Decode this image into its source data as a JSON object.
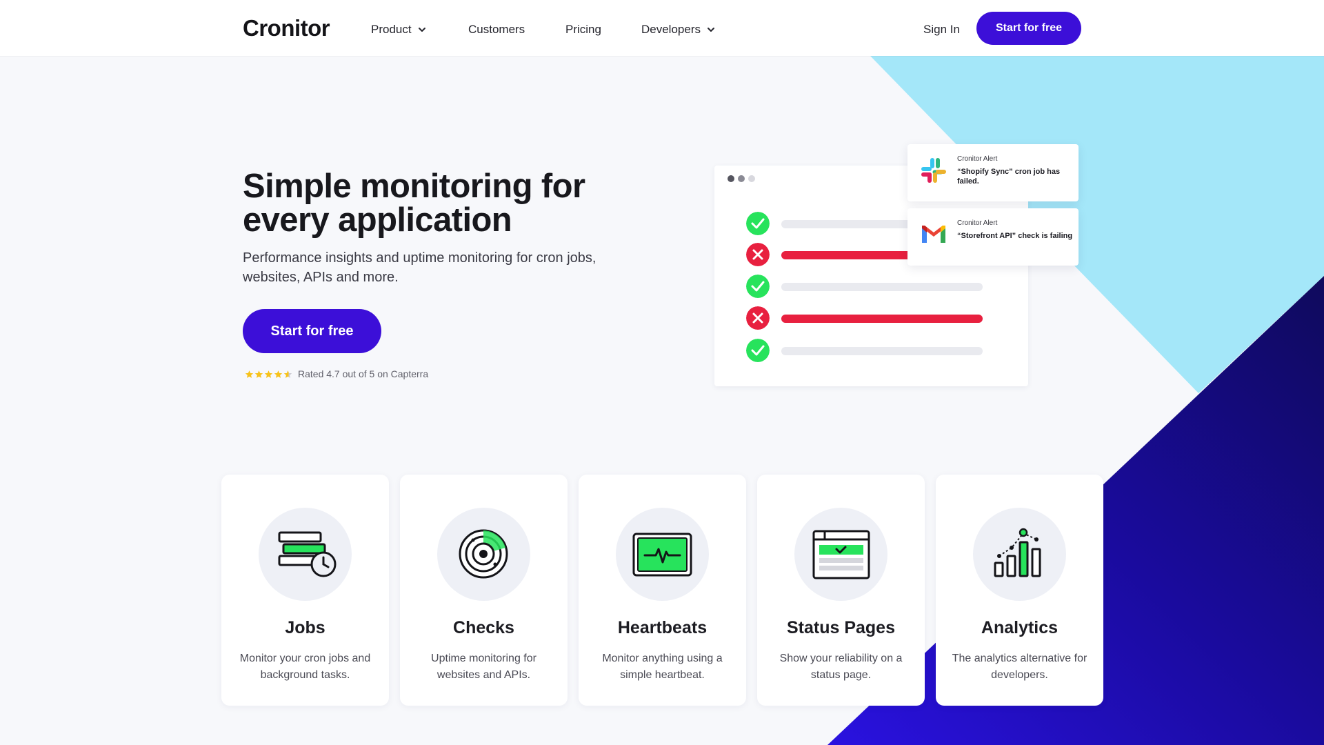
{
  "brand": {
    "name": "Cronitor"
  },
  "nav": {
    "items": [
      {
        "label": "Product",
        "dropdown": true
      },
      {
        "label": "Customers",
        "dropdown": false
      },
      {
        "label": "Pricing",
        "dropdown": false
      },
      {
        "label": "Developers",
        "dropdown": true
      }
    ],
    "signin": "Sign In",
    "cta": "Start for free"
  },
  "hero": {
    "title": "Simple monitoring for every application",
    "subtitle": "Performance insights and uptime monitoring for cron jobs, websites, APIs and more.",
    "cta": "Start for free",
    "rating_text": "Rated 4.7 out of 5 on Capterra",
    "rating_value": 4.7
  },
  "mockup": {
    "rows": [
      {
        "status": "ok"
      },
      {
        "status": "fail"
      },
      {
        "status": "ok"
      },
      {
        "status": "fail"
      },
      {
        "status": "ok"
      }
    ],
    "alerts": [
      {
        "icon": "slack-icon",
        "head": "Cronitor Alert",
        "body": "“Shopify Sync” cron job has failed."
      },
      {
        "icon": "gmail-icon",
        "head": "Cronitor Alert",
        "body": "“Storefront API” check  is failing"
      }
    ]
  },
  "cards": [
    {
      "icon": "jobs-icon",
      "title": "Jobs",
      "desc": "Monitor your cron jobs and background tasks."
    },
    {
      "icon": "checks-icon",
      "title": "Checks",
      "desc": "Uptime monitoring for websites and APIs."
    },
    {
      "icon": "heartbeats-icon",
      "title": "Heartbeats",
      "desc": "Monitor anything using a simple heartbeat."
    },
    {
      "icon": "status-pages-icon",
      "title": "Status Pages",
      "desc": "Show your reliability on a status page."
    },
    {
      "icon": "analytics-icon",
      "title": "Analytics",
      "desc": "The analytics alternative for developers."
    }
  ],
  "colors": {
    "brand": "#3c0fd8",
    "green": "#27e35c",
    "red": "#e8203f",
    "sky": "#a4e7f9",
    "navy": "#150a7a"
  }
}
